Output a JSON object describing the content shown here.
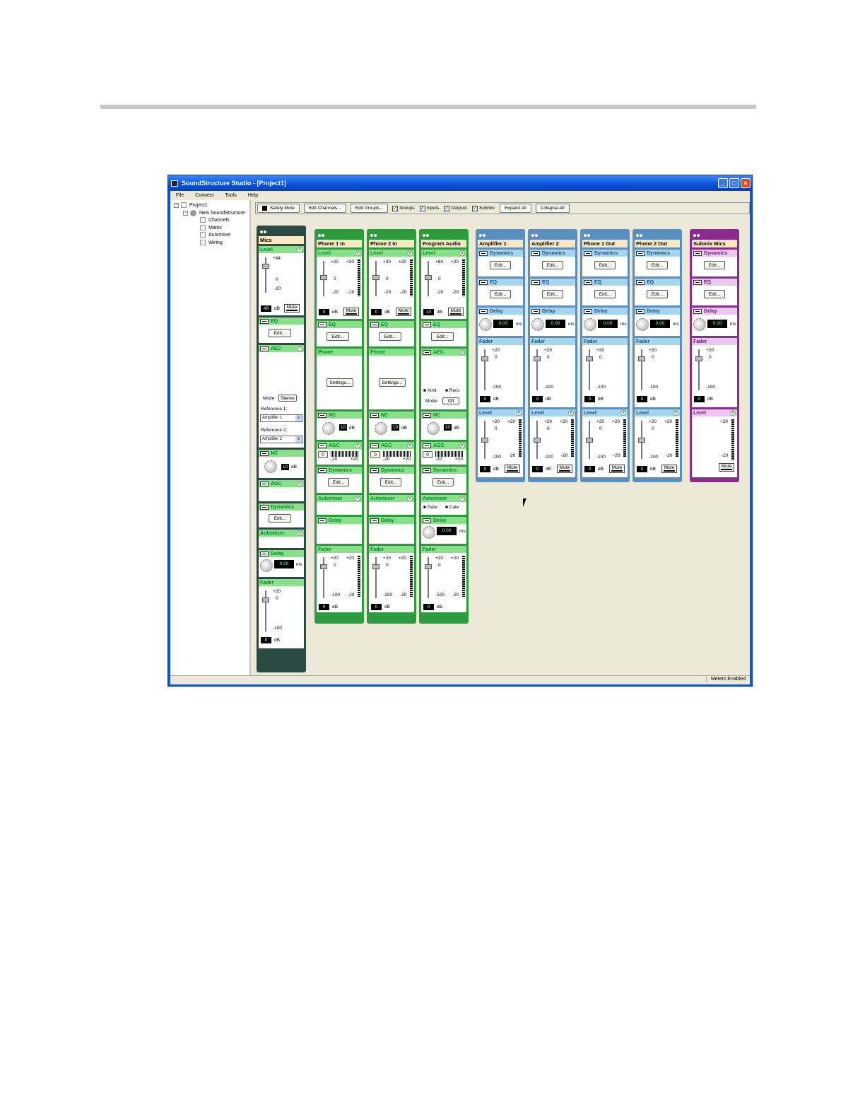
{
  "window": {
    "title": "SoundStructure Studio - [Project1]"
  },
  "menu": [
    "File",
    "Connect",
    "Tools",
    "Help"
  ],
  "tree": {
    "project": "Project1",
    "device": "New SoundStructure",
    "children": [
      "Channels",
      "Matrix",
      "Automixer",
      "Wiring"
    ]
  },
  "toolbar": {
    "safety_mute": "Safety Mute",
    "edit_channels": "Edit Channels...",
    "edit_groups": "Edit Groups...",
    "groups": "Groups",
    "inputs": "Inputs",
    "outputs": "Outputs",
    "submix": "Submix",
    "expand_all": "Expand All",
    "collapse_all": "Collapse All"
  },
  "status": "Meters Enabled",
  "labels": {
    "level": "Level",
    "eq": "EQ",
    "edit": "Edit...",
    "aec": "AEC",
    "nc": "NC",
    "agc": "AGC",
    "dynamics": "Dynamics",
    "automixer": "Automixer",
    "delay": "Delay",
    "fader": "Fader",
    "phone": "Phone",
    "settings": "Settings...",
    "mute": "Mute",
    "db": "dB",
    "ms": "ms",
    "mode": "Mode",
    "stereo": "Stereo",
    "off": "Off",
    "reference1": "Reference 1:",
    "reference2": "Reference 2:",
    "amp1_sel": "Amplifier 1",
    "amp2_sel": "Amplifier 2",
    "xmit": "Xmit",
    "recv": "Recv",
    "gate": "Gate",
    "cate": "Cate",
    "t84": "+84",
    "t20": "+20",
    "t0": "0",
    "tm20": "-20",
    "tm100": "-100",
    "delay_val": "0.00",
    "nc_val": "10",
    "agc_val": "0"
  },
  "mics": {
    "name": "Mics",
    "level_val": "48",
    "fader_val": "0"
  },
  "inputs": [
    {
      "name": "Phone 1 In",
      "level_val": "0",
      "fader_val": "0"
    },
    {
      "name": "Phone 2 In",
      "level_val": "0",
      "fader_val": "0"
    },
    {
      "name": "Program Audio",
      "level_val": "10",
      "fader_val": "0"
    }
  ],
  "outputs": [
    {
      "name": "Amplifier 1",
      "fader_val": "0",
      "level_val": "0"
    },
    {
      "name": "Amplifier 2",
      "fader_val": "0",
      "level_val": "0"
    },
    {
      "name": "Phone 1 Out",
      "fader_val": "0",
      "level_val": "0"
    },
    {
      "name": "Phone 2 Out",
      "fader_val": "0",
      "level_val": "0"
    }
  ],
  "submix": {
    "name": "Submix Mics",
    "fader_val": "0"
  }
}
